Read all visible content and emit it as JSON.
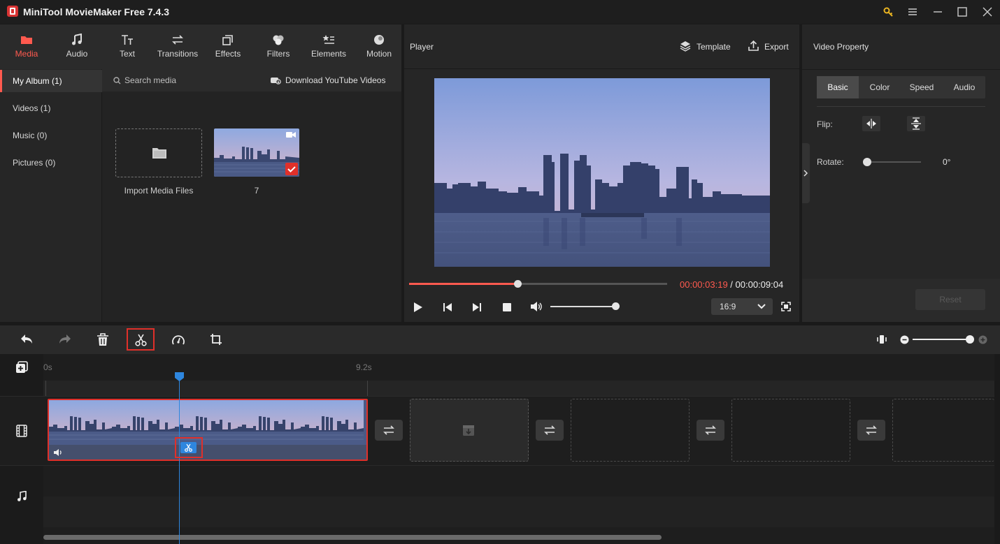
{
  "app": {
    "title": "MiniTool MovieMaker Free 7.4.3"
  },
  "tabs": [
    {
      "label": "Media",
      "icon": "folder-icon",
      "active": true
    },
    {
      "label": "Audio",
      "icon": "music-note-icon"
    },
    {
      "label": "Text",
      "icon": "text-icon"
    },
    {
      "label": "Transitions",
      "icon": "swap-arrows-icon"
    },
    {
      "label": "Effects",
      "icon": "effects-icon"
    },
    {
      "label": "Filters",
      "icon": "filters-icon"
    },
    {
      "label": "Elements",
      "icon": "elements-icon"
    },
    {
      "label": "Motion",
      "icon": "motion-icon"
    }
  ],
  "albums": [
    {
      "label": "My Album (1)",
      "active": true
    },
    {
      "label": "Videos (1)"
    },
    {
      "label": "Music (0)"
    },
    {
      "label": "Pictures (0)"
    }
  ],
  "media": {
    "search_placeholder": "Search media",
    "download_label": "Download YouTube Videos",
    "import_label": "Import Media Files",
    "clip_label": "7"
  },
  "player": {
    "title": "Player",
    "template_label": "Template",
    "export_label": "Export",
    "current_time": "00:00:03:19",
    "separator": " / ",
    "total_time": "00:00:09:04",
    "progress": 0.42,
    "volume": 1.0,
    "aspect": "16:9"
  },
  "property": {
    "title": "Video Property",
    "tabs": [
      "Basic",
      "Color",
      "Speed",
      "Audio"
    ],
    "active_tab": "Basic",
    "flip_label": "Flip:",
    "rotate_label": "Rotate:",
    "rotate_value": "0°",
    "reset_label": "Reset"
  },
  "timeline": {
    "start_label": "0s",
    "end_label": "9.2s",
    "zoom": 1.0
  },
  "colors": {
    "accent": "#ff5a4f",
    "playhead": "#2e86de",
    "highlight_box": "#e0302a"
  }
}
